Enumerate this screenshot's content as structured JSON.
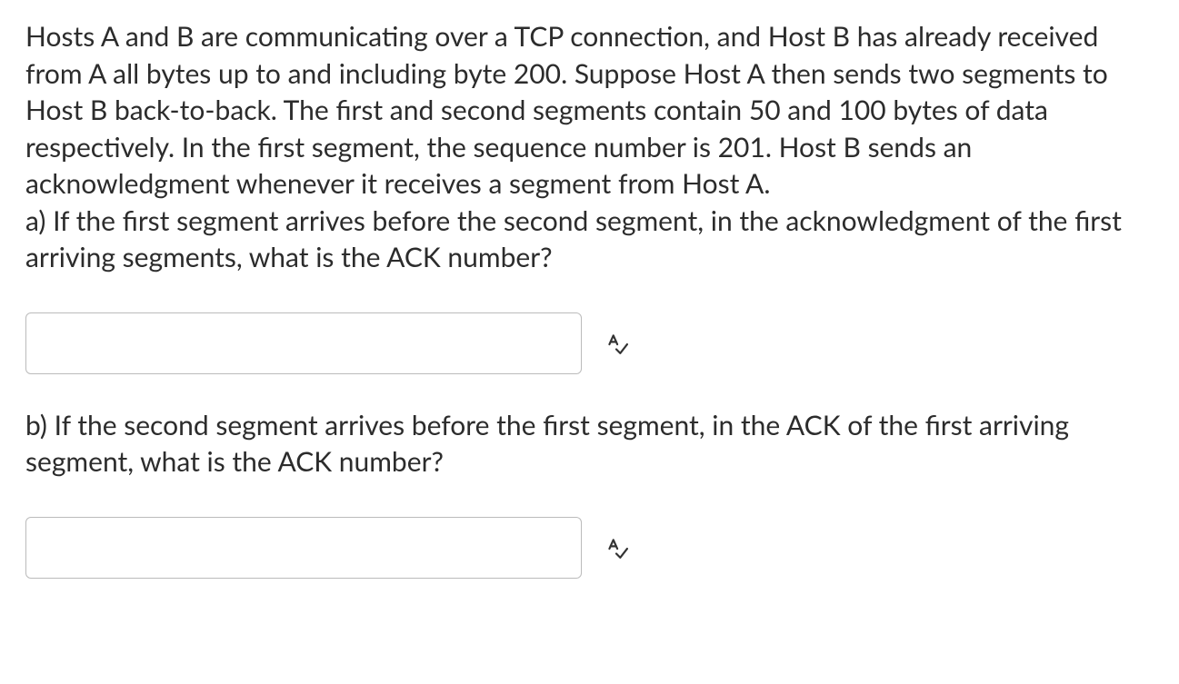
{
  "question": {
    "intro": "Hosts A and B are communicating over a TCP connection, and Host B has already received from A all bytes up to and including byte 200. Suppose Host A then sends two segments to Host B back-to-back. The first and second segments contain 50 and 100 bytes of data respectively. In the first segment, the sequence number is 201. Host B sends an acknowledgment whenever it receives a segment from Host A.",
    "part_a": "a) If the first segment arrives before the second segment, in the acknowledgment of the first arriving segments, what is the ACK number?",
    "part_b": "b) If the second segment arrives before the first segment, in the ACK of the first arriving segment, what is the ACK number?"
  },
  "answers": {
    "a_value": "",
    "b_value": ""
  }
}
